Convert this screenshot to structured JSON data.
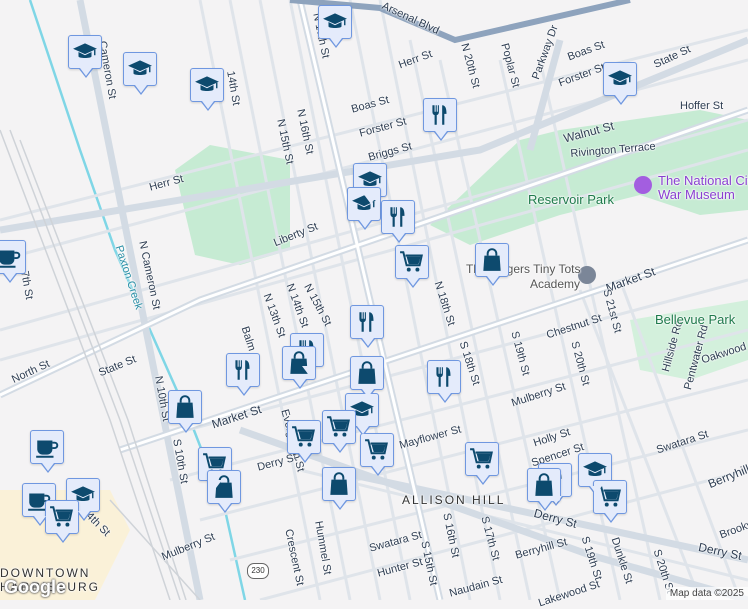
{
  "map": {
    "labels": {
      "arsenal": "Arsenal Blvd",
      "herr1": "Herr St",
      "herr2": "Herr St",
      "boas1": "Boas St",
      "boas2": "Boas St",
      "forster1": "Forster St",
      "forster2": "Forster St",
      "briggs": "Briggs St",
      "n20": "N 20th St",
      "poplar": "Poplar St",
      "parkway": "Parkway Dr",
      "state1": "State St",
      "state2": "State St",
      "hoffer": "Hoffer St",
      "walnut": "Walnut St",
      "rivington": "Rivington Terrace",
      "n17": "N 17th St",
      "n16": "N 16th St",
      "n15a": "N 15th St",
      "n15b": "N 15th St",
      "n14": "N 14th St",
      "n13": "N 13th St",
      "liberty": "Liberty St",
      "market1": "Market St",
      "market2": "Market St",
      "chestnut": "Chestnut St",
      "s21": "S 21st St",
      "s20a": "S 20th St",
      "s20b": "S 20th St",
      "s19a": "S 19th St",
      "s19b": "S 19th St",
      "n18": "N 18th St",
      "s18": "S 18th St",
      "s17": "S 17th St",
      "s16": "S 16th St",
      "s15": "S 15th St",
      "mulberry1": "Mulberry St",
      "mulberry2": "Mulberry St",
      "holly": "Holly St",
      "spencer": "Spencer St",
      "swatara1": "Swatara St",
      "swatara2": "Swatara St",
      "berryhill1": "Berryhill St",
      "berryhill2": "Berryhill St",
      "derry1": "Derry St",
      "derry2": "Derry St",
      "derry3": "Derry St",
      "brookwood": "Brookwood St",
      "dunkle": "Dunkle St",
      "naudain": "Naudain St",
      "hunter": "Hunter St",
      "hummel": "Hummel St",
      "crescent": "Crescent St",
      "mayflower": "Mayflower St",
      "north": "North St",
      "ncameron": "N Cameron St",
      "cameron": "Cameron St",
      "paxton": "Paxton Creek",
      "n10": "N 10th St",
      "s10": "S 10th St",
      "balm": "Balm St",
      "hillside": "Hillside Rd",
      "pentwater": "Pentwater Rd",
      "oakwood": "Oakwood Rd",
      "th14": "14th St",
      "th7": "7th St",
      "th4": "4th St",
      "evergreen": "Evergreen St",
      "lakewood": "Lakewood St"
    },
    "parks": {
      "reservoir": "Reservoir Park",
      "bellevue": "Bellevue Park"
    },
    "pois": {
      "museum_line1": "The National Civil",
      "museum_line2": "War Museum",
      "academy_line1": "The Fingers Tiny Tots",
      "academy_line2": "Academy"
    },
    "areas": {
      "allison": "ALLISON HILL",
      "downtown1": "DOWNTOWN",
      "downtown2": "HARRISBURG"
    },
    "route_shield": "230",
    "logo": "Google",
    "attribution": "Map data ©2025",
    "colors": {
      "marker_fill": "#e4ebfb",
      "marker_border": "#6f97e0",
      "icon": "#0d4a6e",
      "park": "#c6ebd3",
      "museum": "#a35ee0"
    }
  }
}
